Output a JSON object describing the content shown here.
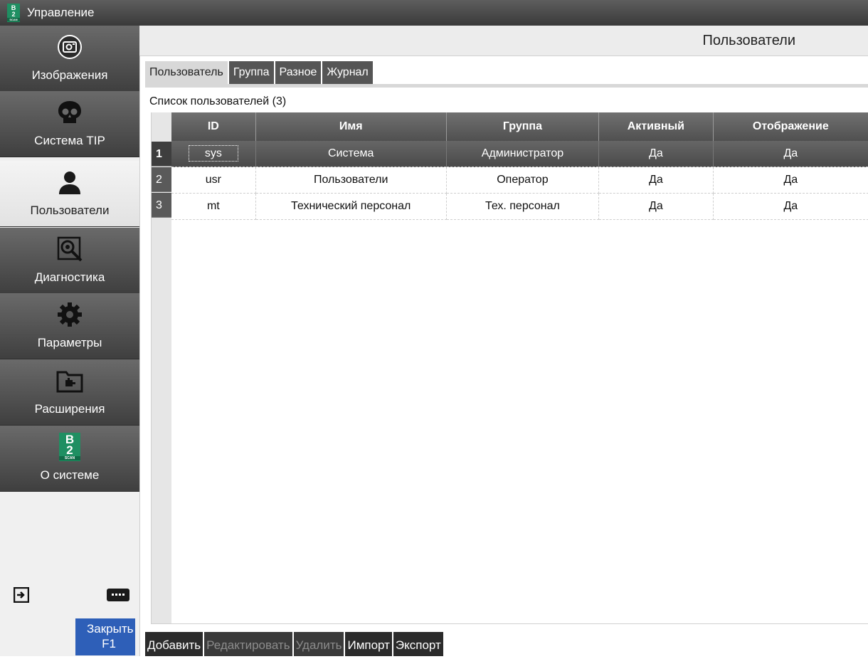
{
  "window": {
    "title": "Управление"
  },
  "header": {
    "title": "Пользователи"
  },
  "sidebar": {
    "items": [
      {
        "label": "Изображения",
        "icon": "camera-icon",
        "active": false
      },
      {
        "label": "Система TIP",
        "icon": "skull-icon",
        "active": false
      },
      {
        "label": "Пользователи",
        "icon": "user-icon",
        "active": true
      },
      {
        "label": "Диагностика",
        "icon": "diagnostics-icon",
        "active": false
      },
      {
        "label": "Параметры",
        "icon": "gear-icon",
        "active": false
      },
      {
        "label": "Расширения",
        "icon": "extensions-folder-icon",
        "active": false
      },
      {
        "label": "О системе",
        "icon": "b2scan-logo-icon",
        "active": false
      }
    ],
    "close_button": {
      "line1": "Закрыть",
      "line2": "F1"
    }
  },
  "logo": {
    "top": "B",
    "middle": "2",
    "bottom": "SCAN"
  },
  "tabs": [
    "Пользователь",
    "Группа",
    "Разное",
    "Журнал"
  ],
  "list": {
    "caption": "Список пользователей (3)",
    "columns": [
      "ID",
      "Имя",
      "Группа",
      "Активный",
      "Отображение"
    ],
    "rows": [
      {
        "num": "1",
        "cells": [
          "sys",
          "Система",
          "Администратор",
          "Да",
          "Да"
        ]
      },
      {
        "num": "2",
        "cells": [
          "usr",
          "Пользователи",
          "Оператор",
          "Да",
          "Да"
        ]
      },
      {
        "num": "3",
        "cells": [
          "mt",
          "Технический персонал",
          "Тех. персонал",
          "Да",
          "Да"
        ]
      }
    ]
  },
  "actions": [
    "Добавить",
    "Редактировать",
    "Удалить",
    "Импорт",
    "Экспорт"
  ],
  "colors": {
    "close_button": "#2e5fb8",
    "logo": "#1f8f62",
    "dark_bar": "#3a3a3a"
  }
}
